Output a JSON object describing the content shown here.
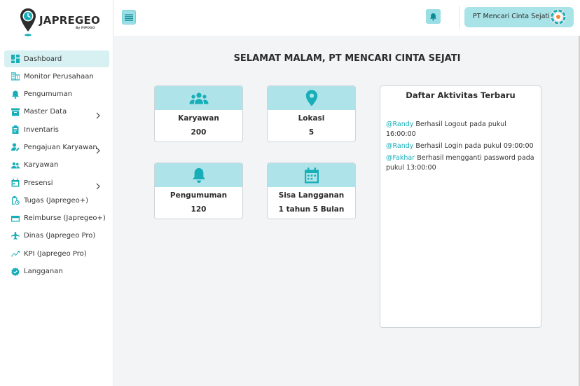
{
  "brand": {
    "name": "JAPREGEO",
    "sub": "By PIPOGO",
    "accent": "#17aeb8",
    "accent_light": "#aee4e9"
  },
  "sidebar": {
    "items": [
      {
        "label": "Dashboard",
        "icon": "dashboard-icon",
        "active": true
      },
      {
        "label": "Monitor Perusahaan",
        "icon": "building-icon"
      },
      {
        "label": "Pengumuman",
        "icon": "bell-icon"
      },
      {
        "label": "Master Data",
        "icon": "archive-icon",
        "has_children": true
      },
      {
        "label": "Inventaris",
        "icon": "clipboard-icon"
      },
      {
        "label": "Pengajuan Karyawan",
        "icon": "person-edit-icon",
        "has_children": true
      },
      {
        "label": "Karyawan",
        "icon": "people-icon"
      },
      {
        "label": "Presensi",
        "icon": "calendar-icon",
        "has_children": true
      },
      {
        "label": "Tugas (Japregeo+)",
        "icon": "task-icon"
      },
      {
        "label": "Reimburse (Japregeo+)",
        "icon": "card-icon"
      },
      {
        "label": "Dinas (Japregeo Pro)",
        "icon": "airplane-icon"
      },
      {
        "label": "KPI (Japregeo Pro)",
        "icon": "trend-icon"
      },
      {
        "label": "Langganan",
        "icon": "verified-icon"
      }
    ]
  },
  "topbar": {
    "company": "PT Mencari Cinta Sejati"
  },
  "main": {
    "greeting": "SELAMAT MALAM, PT MENCARI CINTA SEJATI",
    "cards": [
      {
        "title": "Karyawan",
        "value": "200",
        "icon": "people-icon"
      },
      {
        "title": "Lokasi",
        "value": "5",
        "icon": "location-pin-icon"
      },
      {
        "title": "Pengumuman",
        "value": "120",
        "icon": "bell-icon"
      },
      {
        "title": "Sisa Langganan",
        "value": "1 tahun 5 Bulan",
        "icon": "calendar-icon"
      }
    ],
    "activity": {
      "title": "Daftar Aktivitas Terbaru",
      "items": [
        {
          "who": "@Randy",
          "text": " Berhasil Logout pada pukul 16:00:00"
        },
        {
          "who": "@Randy",
          "text": " Berhasil Login pada pukul 09:00:00"
        },
        {
          "who": "@Fakhar",
          "text": " Berhasil mengganti password pada pukul 13:00:00"
        }
      ]
    }
  }
}
